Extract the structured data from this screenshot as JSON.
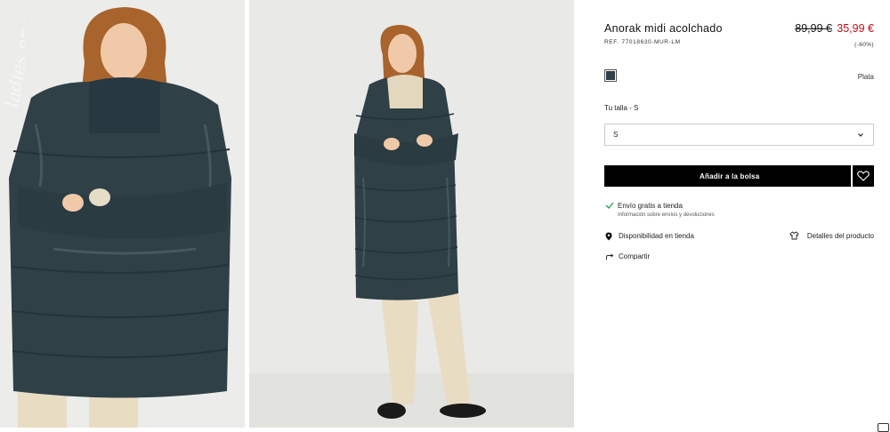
{
  "gallery": {
    "images": [
      {
        "alt": "Anorak midi acolchado - vista frontal"
      },
      {
        "alt": "Anorak midi acolchado - vista completa"
      }
    ],
    "watermark": "ladies.on.us"
  },
  "product": {
    "title": "Anorak midi acolchado",
    "ref_label": "REF.",
    "ref_code": "77018630-MUR-LM",
    "price_old": "89,99 €",
    "price_new": "35,99 €",
    "discount": "(-60%)"
  },
  "color": {
    "selected_name": "Plata",
    "swatch_color": "#2e4048"
  },
  "size": {
    "label": "Tu talla - S",
    "selected": "S"
  },
  "actions": {
    "add_to_bag": "Añadir a la bolsa",
    "favorite_icon": "heart-icon"
  },
  "shipping": {
    "title": "Envío gratis a tienda",
    "subtitle": "Información sobre envíos y devoluciones"
  },
  "links": {
    "availability": "Disponibilidad en tienda",
    "details": "Detalles del producto",
    "share": "Compartir"
  },
  "colors": {
    "price_sale": "#c20e1a",
    "button_bg": "#000000",
    "jacket": "#2e4048"
  }
}
